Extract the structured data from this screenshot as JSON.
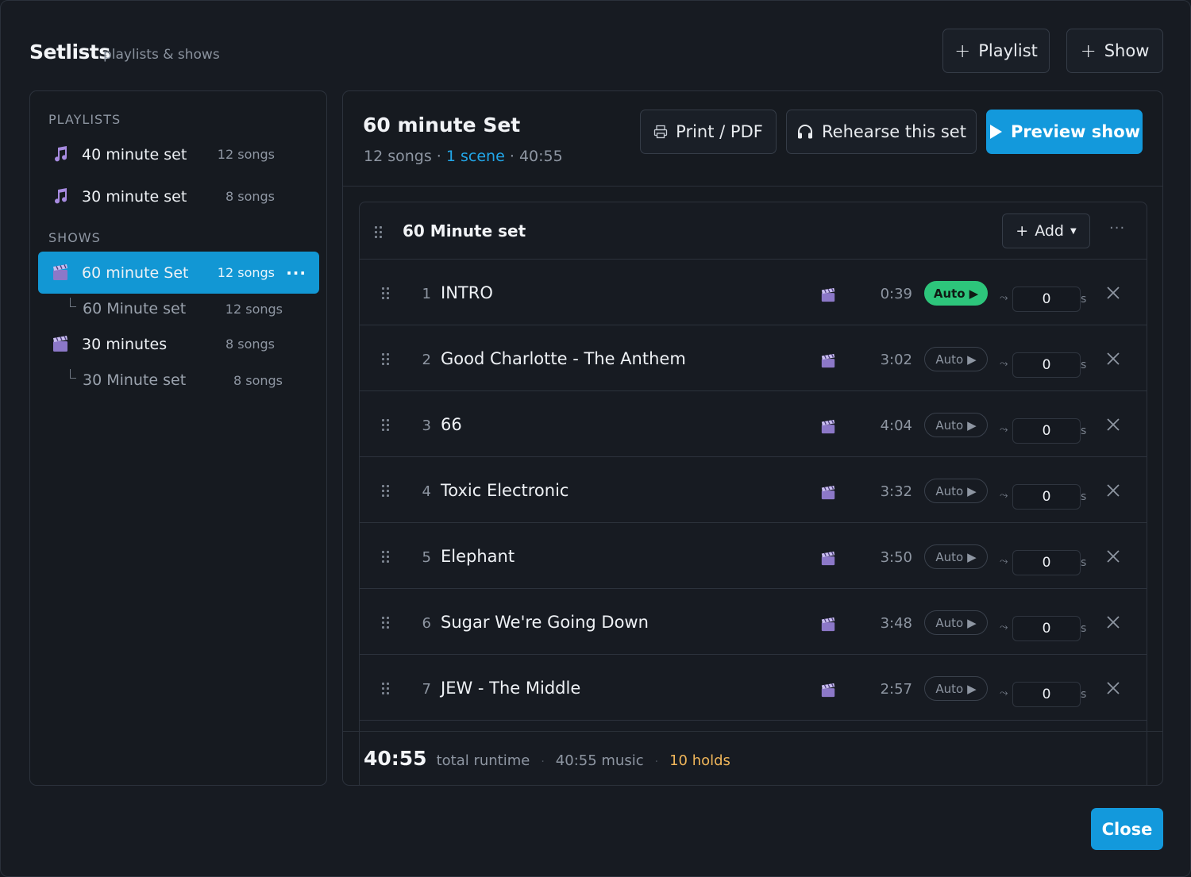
{
  "header": {
    "title": "Setlists",
    "subtitle": "playlists & shows",
    "add_playlist": "Playlist",
    "add_show": "Show",
    "plus": "+"
  },
  "sidebar": {
    "playlists_label": "PLAYLISTS",
    "shows_label": "SHOWS",
    "playlists": [
      {
        "label": "40 minute set",
        "count": "12 songs",
        "icon": "music-note-icon"
      },
      {
        "label": "30 minute set",
        "count": "8 songs",
        "icon": "music-note-icon"
      }
    ],
    "shows": [
      {
        "label": "60 minute Set",
        "count": "12 songs",
        "icon": "clapperboard-icon",
        "active": true,
        "more": "···"
      },
      {
        "label": "60 Minute set",
        "count": "12 songs",
        "sub": true
      },
      {
        "label": "30 minutes",
        "count": "8 songs",
        "icon": "clapperboard-icon"
      },
      {
        "label": "30 Minute set",
        "count": "8 songs",
        "sub": true
      }
    ]
  },
  "main": {
    "title": "60 minute Set",
    "meta_songs": "12 songs",
    "meta_sep": "·",
    "meta_scene": "1 scene",
    "meta_duration": "40:55",
    "print_label": "Print / PDF",
    "rehearse_label": "Rehearse this set",
    "preview_label": "Preview show",
    "scene": {
      "name": "60 Minute set",
      "add_label": "Add",
      "plus": "+",
      "more": "···"
    },
    "rows": [
      {
        "num": "1",
        "title": "INTRO",
        "dur": "0:39",
        "auto": "Auto",
        "auto_on": true,
        "hold": "0",
        "unit": "s"
      },
      {
        "num": "2",
        "title": "Good Charlotte - The Anthem",
        "dur": "3:02",
        "auto": "Auto",
        "auto_on": false,
        "hold": "0",
        "unit": "s"
      },
      {
        "num": "3",
        "title": "66",
        "dur": "4:04",
        "auto": "Auto",
        "auto_on": false,
        "hold": "0",
        "unit": "s"
      },
      {
        "num": "4",
        "title": "Toxic Electronic",
        "dur": "3:32",
        "auto": "Auto",
        "auto_on": false,
        "hold": "0",
        "unit": "s"
      },
      {
        "num": "5",
        "title": "Elephant",
        "dur": "3:50",
        "auto": "Auto",
        "auto_on": false,
        "hold": "0",
        "unit": "s"
      },
      {
        "num": "6",
        "title": "Sugar We're Going Down",
        "dur": "3:48",
        "auto": "Auto",
        "auto_on": false,
        "hold": "0",
        "unit": "s"
      },
      {
        "num": "7",
        "title": "JEW - The Middle",
        "dur": "2:57",
        "auto": "Auto",
        "auto_on": false,
        "hold": "0",
        "unit": "s"
      }
    ],
    "footer": {
      "runtime": "40:55",
      "runtime_label": "total runtime",
      "music": "40:55 music",
      "holds": "10 holds",
      "sep": "·"
    }
  },
  "close_label": "Close",
  "colors": {
    "accent": "#1399dc",
    "auto_on": "#2dc57b",
    "warn": "#f0b65a",
    "link": "#22a6e8"
  }
}
